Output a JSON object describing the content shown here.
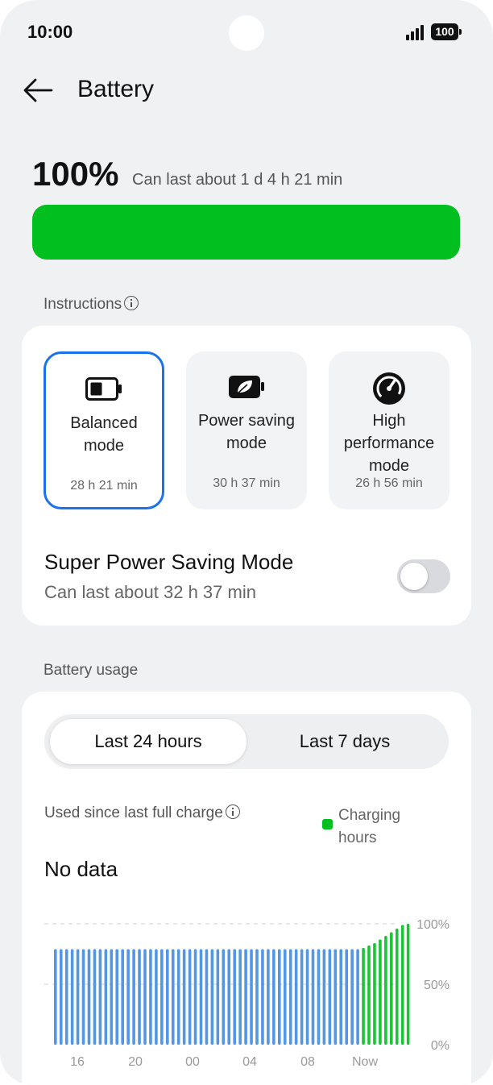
{
  "status_bar": {
    "time": "10:00",
    "battery_level": "100"
  },
  "header": {
    "title": "Battery"
  },
  "summary": {
    "percent": "100%",
    "estimate": "Can last about 1 d 4 h 21 min",
    "level": 1.0,
    "bar_color": "#00bf1e"
  },
  "instructions": {
    "label": "Instructions"
  },
  "modes": [
    {
      "name_lines": [
        "Balanced",
        "mode"
      ],
      "time": "28 h 21 min",
      "selected": true,
      "icon": "battery-icon"
    },
    {
      "name_lines": [
        "Power saving",
        "mode"
      ],
      "time": "30 h 37 min",
      "selected": false,
      "icon": "leaf-battery-icon"
    },
    {
      "name_lines": [
        "High",
        "performance",
        "mode"
      ],
      "time": "26 h 56 min",
      "selected": false,
      "icon": "speedometer-icon"
    }
  ],
  "super_power": {
    "title": "Super Power Saving Mode",
    "subtitle": "Can last about 32 h 37 min",
    "enabled": false
  },
  "usage": {
    "label": "Battery usage",
    "tabs": [
      "Last 24 hours",
      "Last 7 days"
    ],
    "active_tab": 0,
    "used_since": "Used since last full charge",
    "legend_lines": [
      "Charging",
      "hours"
    ],
    "no_data": "No data"
  },
  "colors": {
    "accent": "#1a73e8",
    "usage_bar": "#4a90e2",
    "charging_bar": "#00bf1e"
  },
  "chart_data": {
    "type": "bar",
    "x_tick_labels": [
      "16",
      "20",
      "00",
      "04",
      "08",
      "Now"
    ],
    "y_tick_labels": [
      "100%",
      "50%",
      "0%"
    ],
    "ylim": [
      0,
      100
    ],
    "series": [
      {
        "name": "Charging hours",
        "values": [
          80,
          82,
          84,
          87,
          90,
          93,
          96,
          99,
          100
        ]
      }
    ],
    "usage_values": [
      79,
      79,
      79,
      79,
      79,
      79,
      79,
      79,
      79,
      79,
      79,
      79,
      79,
      79,
      79,
      79,
      79,
      79,
      79,
      79,
      79,
      79,
      79,
      79,
      79,
      79,
      79,
      79,
      79,
      79,
      79,
      79,
      79,
      79,
      79,
      79,
      79,
      79,
      79,
      79,
      79,
      79,
      79,
      79,
      79,
      79,
      79,
      79,
      79,
      79,
      79,
      79,
      79,
      79,
      79
    ]
  }
}
